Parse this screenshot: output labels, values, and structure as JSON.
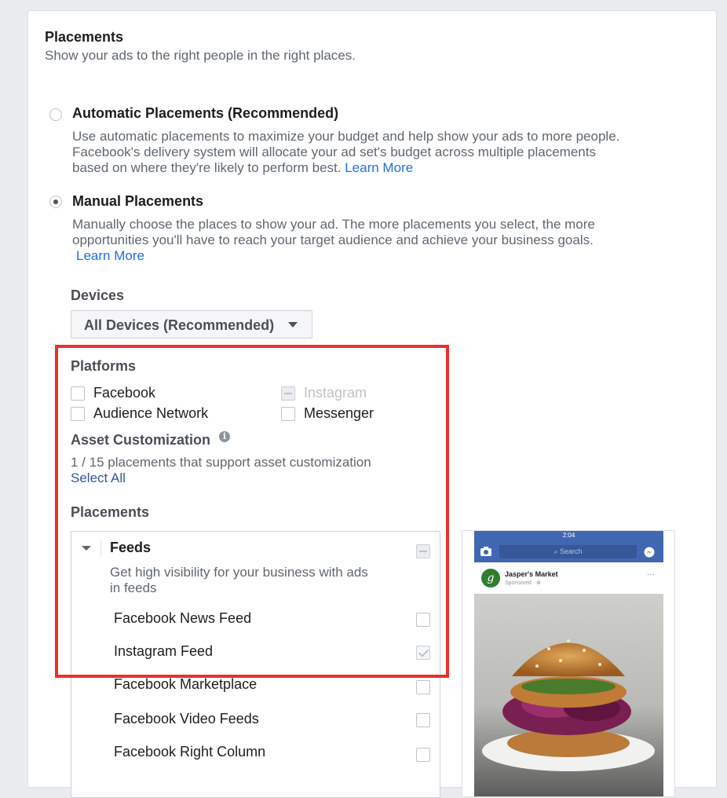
{
  "section": {
    "title": "Placements",
    "subtitle": "Show your ads to the right people in the right places."
  },
  "automatic": {
    "title": "Automatic Placements (Recommended)",
    "line1": "Use automatic placements to maximize your budget and help show your ads to more people.",
    "line2": "Facebook's delivery system will allocate your ad set's budget across multiple placements",
    "line3": "based on where they're likely to perform best.",
    "learn_more": "Learn More",
    "selected": false
  },
  "manual": {
    "title": "Manual Placements",
    "line1": "Manually choose the places to show your ad. The more placements you select, the more",
    "line2": "opportunities you'll have to reach your target audience and achieve your business goals.",
    "learn_more": "Learn More",
    "selected": true
  },
  "devices": {
    "label": "Devices",
    "value": "All Devices (Recommended)"
  },
  "platforms": {
    "label": "Platforms",
    "items": [
      {
        "label": "Facebook",
        "state": "unchecked"
      },
      {
        "label": "Instagram",
        "state": "indeterminate-disabled"
      },
      {
        "label": "Audience Network",
        "state": "unchecked"
      },
      {
        "label": "Messenger",
        "state": "unchecked"
      }
    ]
  },
  "asset_customization": {
    "label": "Asset Customization",
    "info_icon": "i",
    "summary": "1 / 15 placements that support asset customization",
    "select_all": "Select All"
  },
  "placements": {
    "label": "Placements",
    "group": {
      "title": "Feeds",
      "desc_line1": "Get high visibility for your business with ads",
      "desc_line2": "in feeds"
    },
    "items": [
      {
        "label": "Facebook News Feed",
        "state": "unchecked"
      },
      {
        "label": "Instagram Feed",
        "state": "checked-disabled"
      },
      {
        "label": "Facebook Marketplace",
        "state": "unchecked"
      },
      {
        "label": "Facebook Video Feeds",
        "state": "unchecked"
      },
      {
        "label": "Facebook Right Column",
        "state": "unchecked"
      }
    ]
  },
  "preview": {
    "time": "2:04",
    "search_placeholder": "Search",
    "page_name": "Jasper's Market",
    "sponsored": "Sponsored · ⊕",
    "more": "···",
    "avatar_letter": "g"
  },
  "colors": {
    "highlight_frame": "#e8322d",
    "link": "#216fdb",
    "facebook_blue": "#4267b2"
  }
}
